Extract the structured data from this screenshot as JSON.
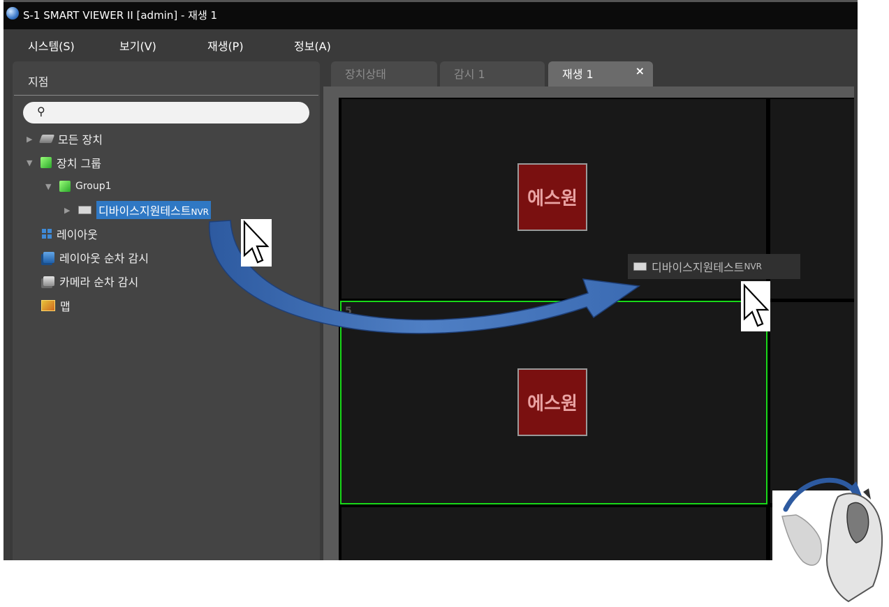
{
  "window": {
    "title": "S-1 SMART VIEWER II [admin] - 재생 1"
  },
  "menu": {
    "items": [
      "시스템(S)",
      "보기(V)",
      "재생(P)",
      "정보(A)"
    ]
  },
  "sidebar": {
    "header": "지점",
    "search": {
      "value": "",
      "placeholder": ""
    },
    "tree": {
      "all_devices": "모든 장치",
      "device_group": "장치 그룹",
      "group1": "Group1",
      "device_name": "디바이스지원테스트",
      "device_type": "NVR",
      "layout": "레이아웃",
      "layout_sequence": "레이아웃 순차 감시",
      "camera_sequence": "카메라 순차 감시",
      "map": "맵"
    }
  },
  "tabs": [
    {
      "label": "장치상태",
      "active": false
    },
    {
      "label": "감시 1",
      "active": false
    },
    {
      "label": "재생 1",
      "active": true,
      "close": "×"
    }
  ],
  "video_grid": {
    "logo_text": "에스원",
    "selected_cell_number": "5",
    "selected_border_color": "#19d919"
  },
  "drag": {
    "label_name": "디바이스지원테스트",
    "label_type": "NVR",
    "arrow_color": "#3f6fb5"
  },
  "colors": {
    "selection": "#2f78c4",
    "logo_bg": "#7a1010",
    "titlebar": "#0b0b0b"
  }
}
